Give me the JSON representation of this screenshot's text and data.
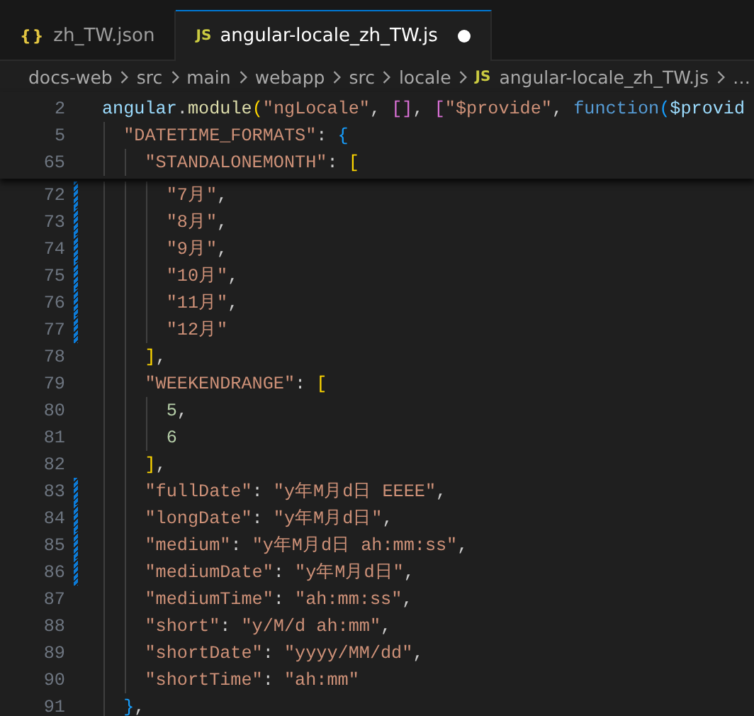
{
  "tabs": [
    {
      "label": "zh_TW.json",
      "kind": "json",
      "icon": "{}",
      "selected": false,
      "modified": false
    },
    {
      "label": "angular-locale_zh_TW.js",
      "kind": "js",
      "icon": "JS",
      "selected": true,
      "modified": true
    }
  ],
  "breadcrumbs": [
    {
      "label": "docs-web"
    },
    {
      "label": "src"
    },
    {
      "label": "main"
    },
    {
      "label": "webapp"
    },
    {
      "label": "src"
    },
    {
      "label": "locale"
    },
    {
      "label": "angular-locale_zh_TW.js",
      "icon": "JS"
    },
    {
      "label": "…"
    }
  ],
  "lines": [
    {
      "number": "2",
      "modified": false,
      "tokens": [
        {
          "text": "angular",
          "kind": "var"
        },
        {
          "text": ".",
          "kind": "punct"
        },
        {
          "text": "module",
          "kind": "fn"
        },
        {
          "text": "(",
          "kind": "b1"
        },
        {
          "text": "\"ngLocale\"",
          "kind": "str"
        },
        {
          "text": ", ",
          "kind": "punct"
        },
        {
          "text": "[]",
          "kind": "b2"
        },
        {
          "text": ", ",
          "kind": "punct"
        },
        {
          "text": "[",
          "kind": "b2"
        },
        {
          "text": "\"$provide\"",
          "kind": "str"
        },
        {
          "text": ", ",
          "kind": "punct"
        },
        {
          "text": "function",
          "kind": "kw"
        },
        {
          "text": "(",
          "kind": "b3"
        },
        {
          "text": "$provid",
          "kind": "var"
        }
      ],
      "children": [
        {
          "number": "5",
          "modified": false,
          "tokens": [
            {
              "text": "\"DATETIME_FORMATS\"",
              "kind": "str"
            },
            {
              "text": ": ",
              "kind": "punct"
            },
            {
              "text": "{",
              "kind": "b3"
            }
          ],
          "children": [
            {
              "number": "65",
              "modified": false,
              "tokens": [
                {
                  "text": "\"STANDALONEMONTH\"",
                  "kind": "str"
                },
                {
                  "text": ": ",
                  "kind": "punct"
                },
                {
                  "text": "[",
                  "kind": "b1"
                }
              ],
              "children": [
                {
                  "number": "72",
                  "modified": true,
                  "tokens": [
                    {
                      "text": "\"7月\"",
                      "kind": "str"
                    },
                    {
                      "text": ",",
                      "kind": "punct"
                    }
                  ]
                },
                {
                  "number": "73",
                  "modified": true,
                  "tokens": [
                    {
                      "text": "\"8月\"",
                      "kind": "str"
                    },
                    {
                      "text": ",",
                      "kind": "punct"
                    }
                  ]
                },
                {
                  "number": "74",
                  "modified": true,
                  "tokens": [
                    {
                      "text": "\"9月\"",
                      "kind": "str"
                    },
                    {
                      "text": ",",
                      "kind": "punct"
                    }
                  ]
                },
                {
                  "number": "75",
                  "modified": true,
                  "tokens": [
                    {
                      "text": "\"10月\"",
                      "kind": "str"
                    },
                    {
                      "text": ",",
                      "kind": "punct"
                    }
                  ]
                },
                {
                  "number": "76",
                  "modified": true,
                  "tokens": [
                    {
                      "text": "\"11月\"",
                      "kind": "str"
                    },
                    {
                      "text": ",",
                      "kind": "punct"
                    }
                  ]
                },
                {
                  "number": "77",
                  "modified": true,
                  "tokens": [
                    {
                      "text": "\"12月\"",
                      "kind": "str"
                    }
                  ]
                }
              ]
            },
            {
              "number": "78",
              "modified": false,
              "tokens": [
                {
                  "text": "]",
                  "kind": "b1"
                },
                {
                  "text": ",",
                  "kind": "punct"
                }
              ]
            },
            {
              "number": "79",
              "modified": false,
              "tokens": [
                {
                  "text": "\"WEEKENDRANGE\"",
                  "kind": "str"
                },
                {
                  "text": ": ",
                  "kind": "punct"
                },
                {
                  "text": "[",
                  "kind": "b1"
                }
              ],
              "children": [
                {
                  "number": "80",
                  "modified": false,
                  "tokens": [
                    {
                      "text": "5",
                      "kind": "num"
                    },
                    {
                      "text": ",",
                      "kind": "punct"
                    }
                  ]
                },
                {
                  "number": "81",
                  "modified": false,
                  "tokens": [
                    {
                      "text": "6",
                      "kind": "num"
                    }
                  ]
                }
              ]
            },
            {
              "number": "82",
              "modified": false,
              "tokens": [
                {
                  "text": "]",
                  "kind": "b1"
                },
                {
                  "text": ",",
                  "kind": "punct"
                }
              ]
            },
            {
              "number": "83",
              "modified": true,
              "tokens": [
                {
                  "text": "\"fullDate\"",
                  "kind": "str"
                },
                {
                  "text": ": ",
                  "kind": "punct"
                },
                {
                  "text": "\"y年M月d日 EEEE\"",
                  "kind": "str"
                },
                {
                  "text": ",",
                  "kind": "punct"
                }
              ]
            },
            {
              "number": "84",
              "modified": true,
              "tokens": [
                {
                  "text": "\"longDate\"",
                  "kind": "str"
                },
                {
                  "text": ": ",
                  "kind": "punct"
                },
                {
                  "text": "\"y年M月d日\"",
                  "kind": "str"
                },
                {
                  "text": ",",
                  "kind": "punct"
                }
              ]
            },
            {
              "number": "85",
              "modified": true,
              "tokens": [
                {
                  "text": "\"medium\"",
                  "kind": "str"
                },
                {
                  "text": ": ",
                  "kind": "punct"
                },
                {
                  "text": "\"y年M月d日 ah:mm:ss\"",
                  "kind": "str"
                },
                {
                  "text": ",",
                  "kind": "punct"
                }
              ]
            },
            {
              "number": "86",
              "modified": true,
              "tokens": [
                {
                  "text": "\"mediumDate\"",
                  "kind": "str"
                },
                {
                  "text": ": ",
                  "kind": "punct"
                },
                {
                  "text": "\"y年M月d日\"",
                  "kind": "str"
                },
                {
                  "text": ",",
                  "kind": "punct"
                }
              ]
            },
            {
              "number": "87",
              "modified": false,
              "tokens": [
                {
                  "text": "\"mediumTime\"",
                  "kind": "str"
                },
                {
                  "text": ": ",
                  "kind": "punct"
                },
                {
                  "text": "\"ah:mm:ss\"",
                  "kind": "str"
                },
                {
                  "text": ",",
                  "kind": "punct"
                }
              ]
            },
            {
              "number": "88",
              "modified": false,
              "tokens": [
                {
                  "text": "\"short\"",
                  "kind": "str"
                },
                {
                  "text": ": ",
                  "kind": "punct"
                },
                {
                  "text": "\"y/M/d ah:mm\"",
                  "kind": "str"
                },
                {
                  "text": ",",
                  "kind": "punct"
                }
              ]
            },
            {
              "number": "89",
              "modified": false,
              "tokens": [
                {
                  "text": "\"shortDate\"",
                  "kind": "str"
                },
                {
                  "text": ": ",
                  "kind": "punct"
                },
                {
                  "text": "\"yyyy/MM/dd\"",
                  "kind": "str"
                },
                {
                  "text": ",",
                  "kind": "punct"
                }
              ]
            },
            {
              "number": "90",
              "modified": false,
              "tokens": [
                {
                  "text": "\"shortTime\"",
                  "kind": "str"
                },
                {
                  "text": ": ",
                  "kind": "punct"
                },
                {
                  "text": "\"ah:mm\"",
                  "kind": "str"
                }
              ]
            }
          ]
        },
        {
          "number": "91",
          "modified": false,
          "tokens": [
            {
              "text": "}",
              "kind": "b3"
            },
            {
              "text": ",",
              "kind": "punct"
            }
          ]
        }
      ]
    }
  ]
}
